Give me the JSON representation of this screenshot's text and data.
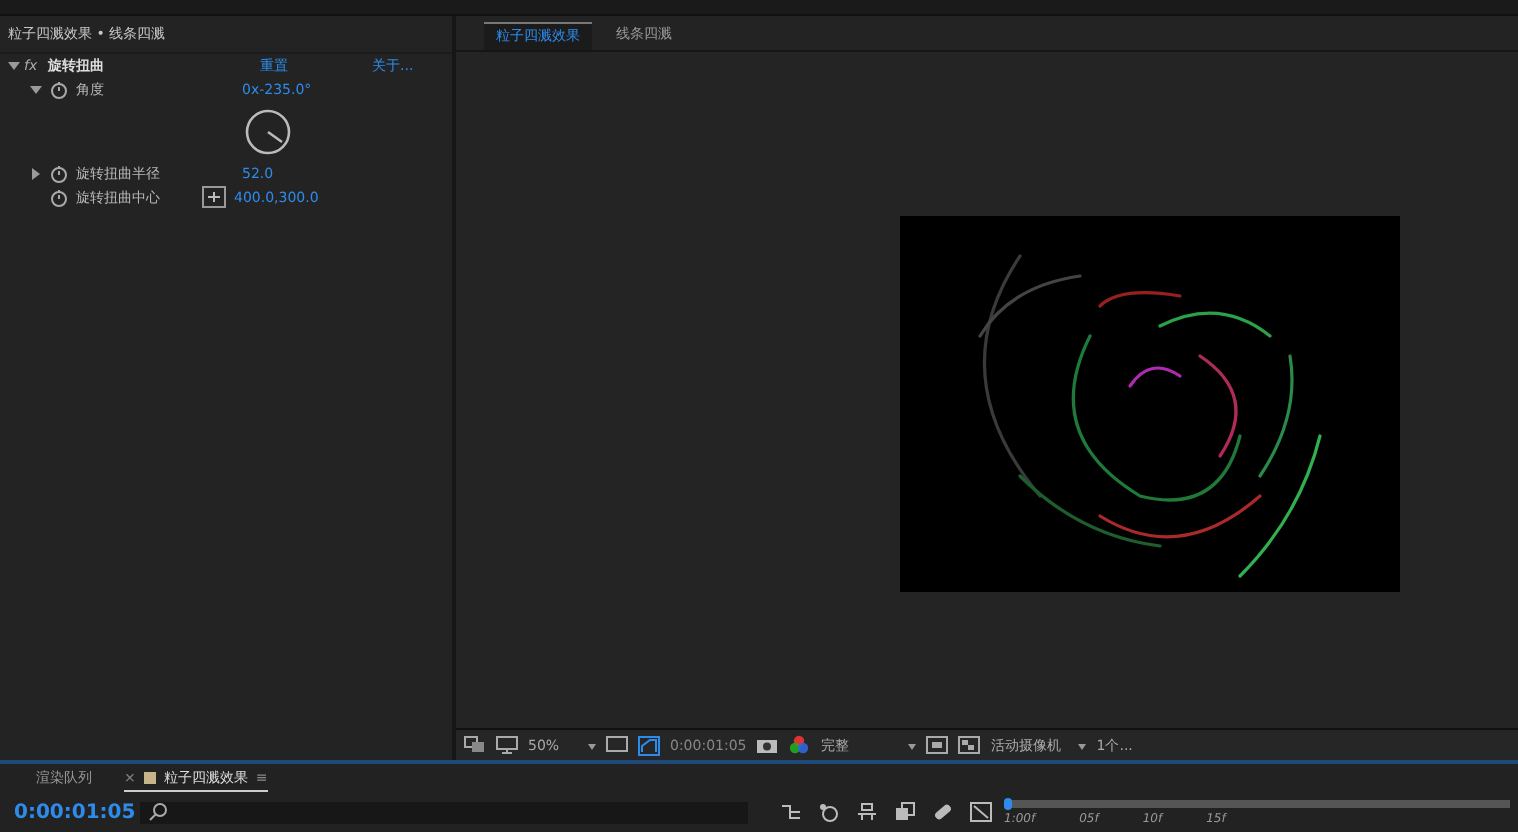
{
  "effect_controls": {
    "title": "粒子四溅效果 • 线条四溅",
    "effect": {
      "badge": "fx",
      "name": "旋转扭曲",
      "expanded": true,
      "reset": "重置",
      "about": "关于..."
    },
    "properties": [
      {
        "kind": "angle",
        "name": "角度",
        "expanded": true,
        "value": "0x-235.0°"
      },
      {
        "kind": "number",
        "name": "旋转扭曲半径",
        "expanded": false,
        "value": "52.0"
      },
      {
        "kind": "point",
        "name": "旋转扭曲中心",
        "value": "400.0,300.0"
      }
    ]
  },
  "viewer": {
    "tabs": [
      {
        "label": "粒子四溅效果",
        "selected": true
      },
      {
        "label": "线条四溅",
        "selected": false
      }
    ],
    "toolbar": {
      "zoom": "50%",
      "timecode": "0:00:01:05",
      "resolution": "完整",
      "camera": "活动摄像机",
      "views": "1个..."
    }
  },
  "timeline": {
    "tabs": [
      {
        "label": "渲染队列",
        "selected": false
      },
      {
        "label": "粒子四溅效果",
        "selected": true,
        "close": "×",
        "menu": "≡"
      }
    ],
    "timecode": "0:00:01:05",
    "ruler": [
      "1:00f",
      "05f",
      "10f",
      "15f"
    ]
  }
}
